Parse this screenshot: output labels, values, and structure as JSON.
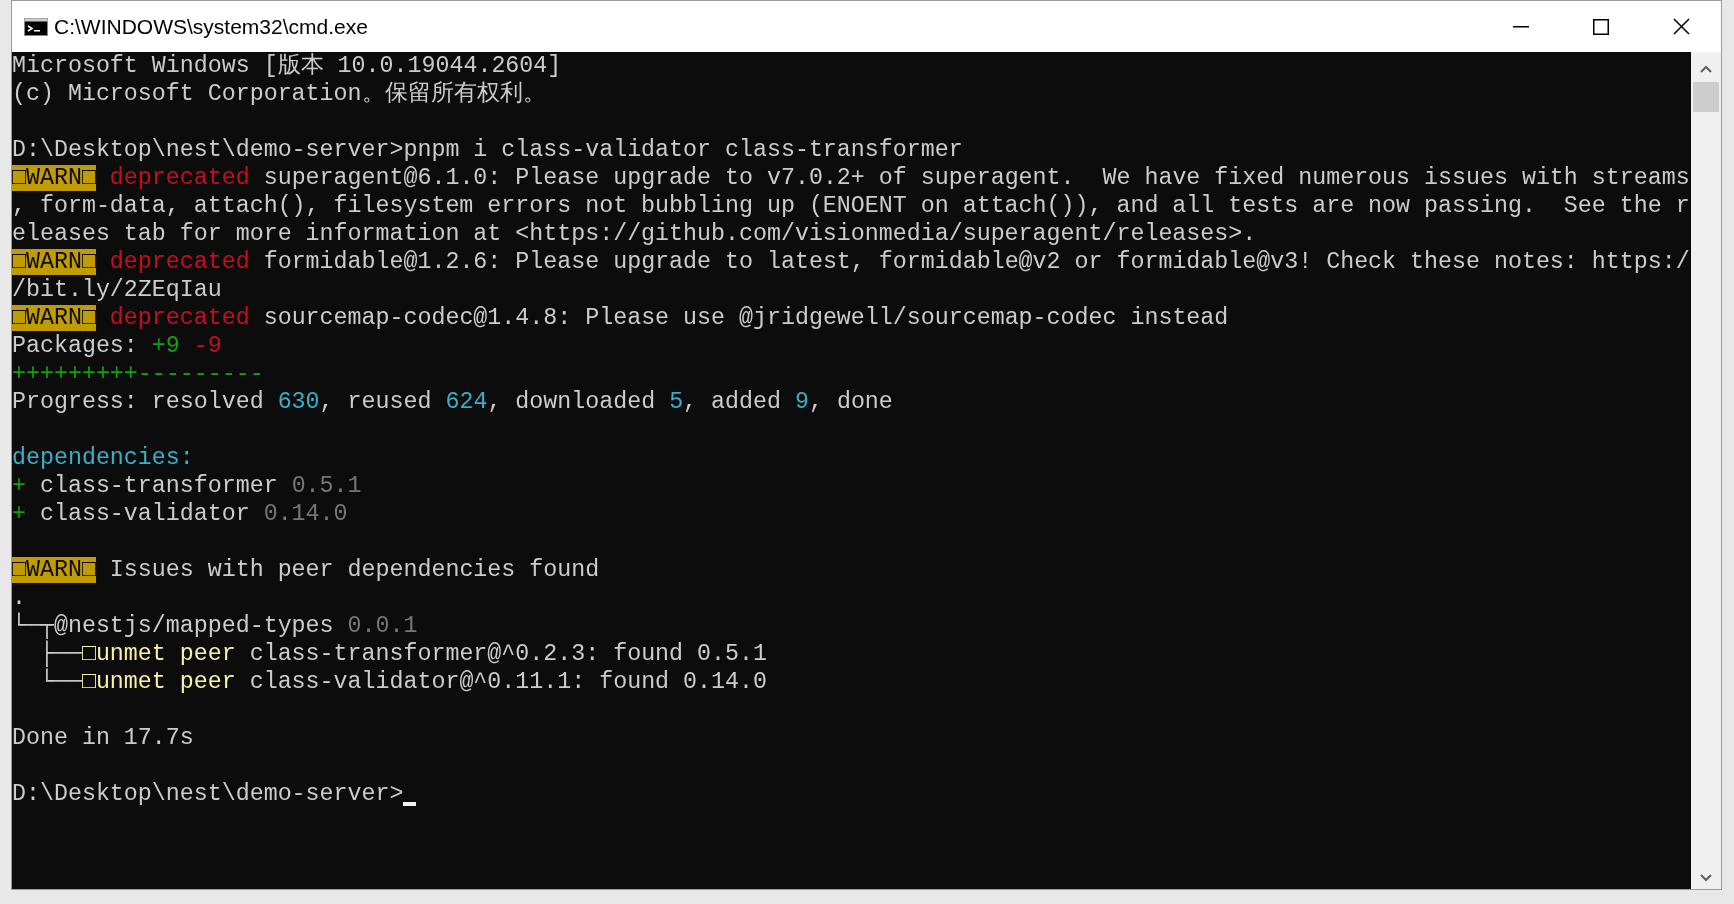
{
  "window": {
    "title": "C:\\WINDOWS\\system32\\cmd.exe"
  },
  "lines": [
    {
      "kind": "text",
      "segments": [
        {
          "kind": "plain",
          "text": "Microsoft Windows [版本 10.0.19044.2604]"
        }
      ]
    },
    {
      "kind": "text",
      "segments": [
        {
          "kind": "plain",
          "text": "(c) Microsoft Corporation。保留所有权利。"
        }
      ]
    },
    {
      "kind": "blank"
    },
    {
      "kind": "text",
      "segments": [
        {
          "kind": "plain",
          "text": "D:\\Desktop\\nest\\demo-server>pnpm i class-validator class-transformer"
        }
      ]
    },
    {
      "kind": "text",
      "segments": [
        {
          "kind": "badge",
          "text": "□WARN□"
        },
        {
          "kind": "red",
          "text": " deprecated"
        },
        {
          "kind": "plain",
          "text": " superagent@6.1.0: Please upgrade to v7.0.2+ of superagent.  We have fixed numerous issues with streams"
        }
      ]
    },
    {
      "kind": "text",
      "segments": [
        {
          "kind": "plain",
          "text": ", form-data, attach(), filesystem errors not bubbling up (ENOENT on attach()), and all tests are now passing.  See the r"
        }
      ]
    },
    {
      "kind": "text",
      "segments": [
        {
          "kind": "plain",
          "text": "eleases tab for more information at <https://github.com/visionmedia/superagent/releases>."
        }
      ]
    },
    {
      "kind": "text",
      "segments": [
        {
          "kind": "badge",
          "text": "□WARN□"
        },
        {
          "kind": "red",
          "text": " deprecated"
        },
        {
          "kind": "plain",
          "text": " formidable@1.2.6: Please upgrade to latest, formidable@v2 or formidable@v3! Check these notes: https:/"
        }
      ]
    },
    {
      "kind": "text",
      "segments": [
        {
          "kind": "plain",
          "text": "/bit.ly/2ZEqIau"
        }
      ]
    },
    {
      "kind": "text",
      "segments": [
        {
          "kind": "badge",
          "text": "□WARN□"
        },
        {
          "kind": "red",
          "text": " deprecated"
        },
        {
          "kind": "plain",
          "text": " sourcemap-codec@1.4.8: Please use @jridgewell/sourcemap-codec instead"
        }
      ]
    },
    {
      "kind": "text",
      "segments": [
        {
          "kind": "plain",
          "text": "Packages: "
        },
        {
          "kind": "green",
          "text": "+9"
        },
        {
          "kind": "red",
          "text": " -9"
        }
      ]
    },
    {
      "kind": "text",
      "segments": [
        {
          "kind": "green",
          "text": "+++++++++---------"
        }
      ]
    },
    {
      "kind": "text",
      "segments": [
        {
          "kind": "plain",
          "text": "Progress: resolved "
        },
        {
          "kind": "cyan",
          "text": "630"
        },
        {
          "kind": "plain",
          "text": ", reused "
        },
        {
          "kind": "cyan",
          "text": "624"
        },
        {
          "kind": "plain",
          "text": ", downloaded "
        },
        {
          "kind": "cyan",
          "text": "5"
        },
        {
          "kind": "plain",
          "text": ", added "
        },
        {
          "kind": "cyan",
          "text": "9"
        },
        {
          "kind": "plain",
          "text": ", done"
        }
      ]
    },
    {
      "kind": "blank"
    },
    {
      "kind": "text",
      "segments": [
        {
          "kind": "cyan",
          "text": "dependencies:"
        }
      ]
    },
    {
      "kind": "text",
      "segments": [
        {
          "kind": "green",
          "text": "+"
        },
        {
          "kind": "plain",
          "text": " class-transformer "
        },
        {
          "kind": "gray",
          "text": "0.5.1"
        }
      ]
    },
    {
      "kind": "text",
      "segments": [
        {
          "kind": "green",
          "text": "+"
        },
        {
          "kind": "plain",
          "text": " class-validator "
        },
        {
          "kind": "gray",
          "text": "0.14.0"
        }
      ]
    },
    {
      "kind": "blank"
    },
    {
      "kind": "text",
      "segments": [
        {
          "kind": "badge",
          "text": "□WARN□"
        },
        {
          "kind": "plain",
          "text": " Issues with peer dependencies found"
        }
      ]
    },
    {
      "kind": "text",
      "segments": [
        {
          "kind": "plain",
          "text": "."
        }
      ]
    },
    {
      "kind": "text",
      "segments": [
        {
          "kind": "plain",
          "text": "└─┬@nestjs/mapped-types "
        },
        {
          "kind": "gray",
          "text": "0.0.1"
        }
      ]
    },
    {
      "kind": "text",
      "segments": [
        {
          "kind": "plain",
          "text": "  ├──"
        },
        {
          "kind": "yellow",
          "text": "□unmet peer"
        },
        {
          "kind": "plain",
          "text": " class-transformer@^0.2.3: found 0.5.1"
        }
      ]
    },
    {
      "kind": "text",
      "segments": [
        {
          "kind": "plain",
          "text": "  └──"
        },
        {
          "kind": "yellow",
          "text": "□unmet peer"
        },
        {
          "kind": "plain",
          "text": " class-validator@^0.11.1: found 0.14.0"
        }
      ]
    },
    {
      "kind": "blank"
    },
    {
      "kind": "text",
      "segments": [
        {
          "kind": "plain",
          "text": "Done in 17.7s"
        }
      ]
    },
    {
      "kind": "blank"
    },
    {
      "kind": "text",
      "segments": [
        {
          "kind": "plain",
          "text": "D:\\Desktop\\nest\\demo-server>"
        }
      ],
      "cursor": true
    }
  ]
}
